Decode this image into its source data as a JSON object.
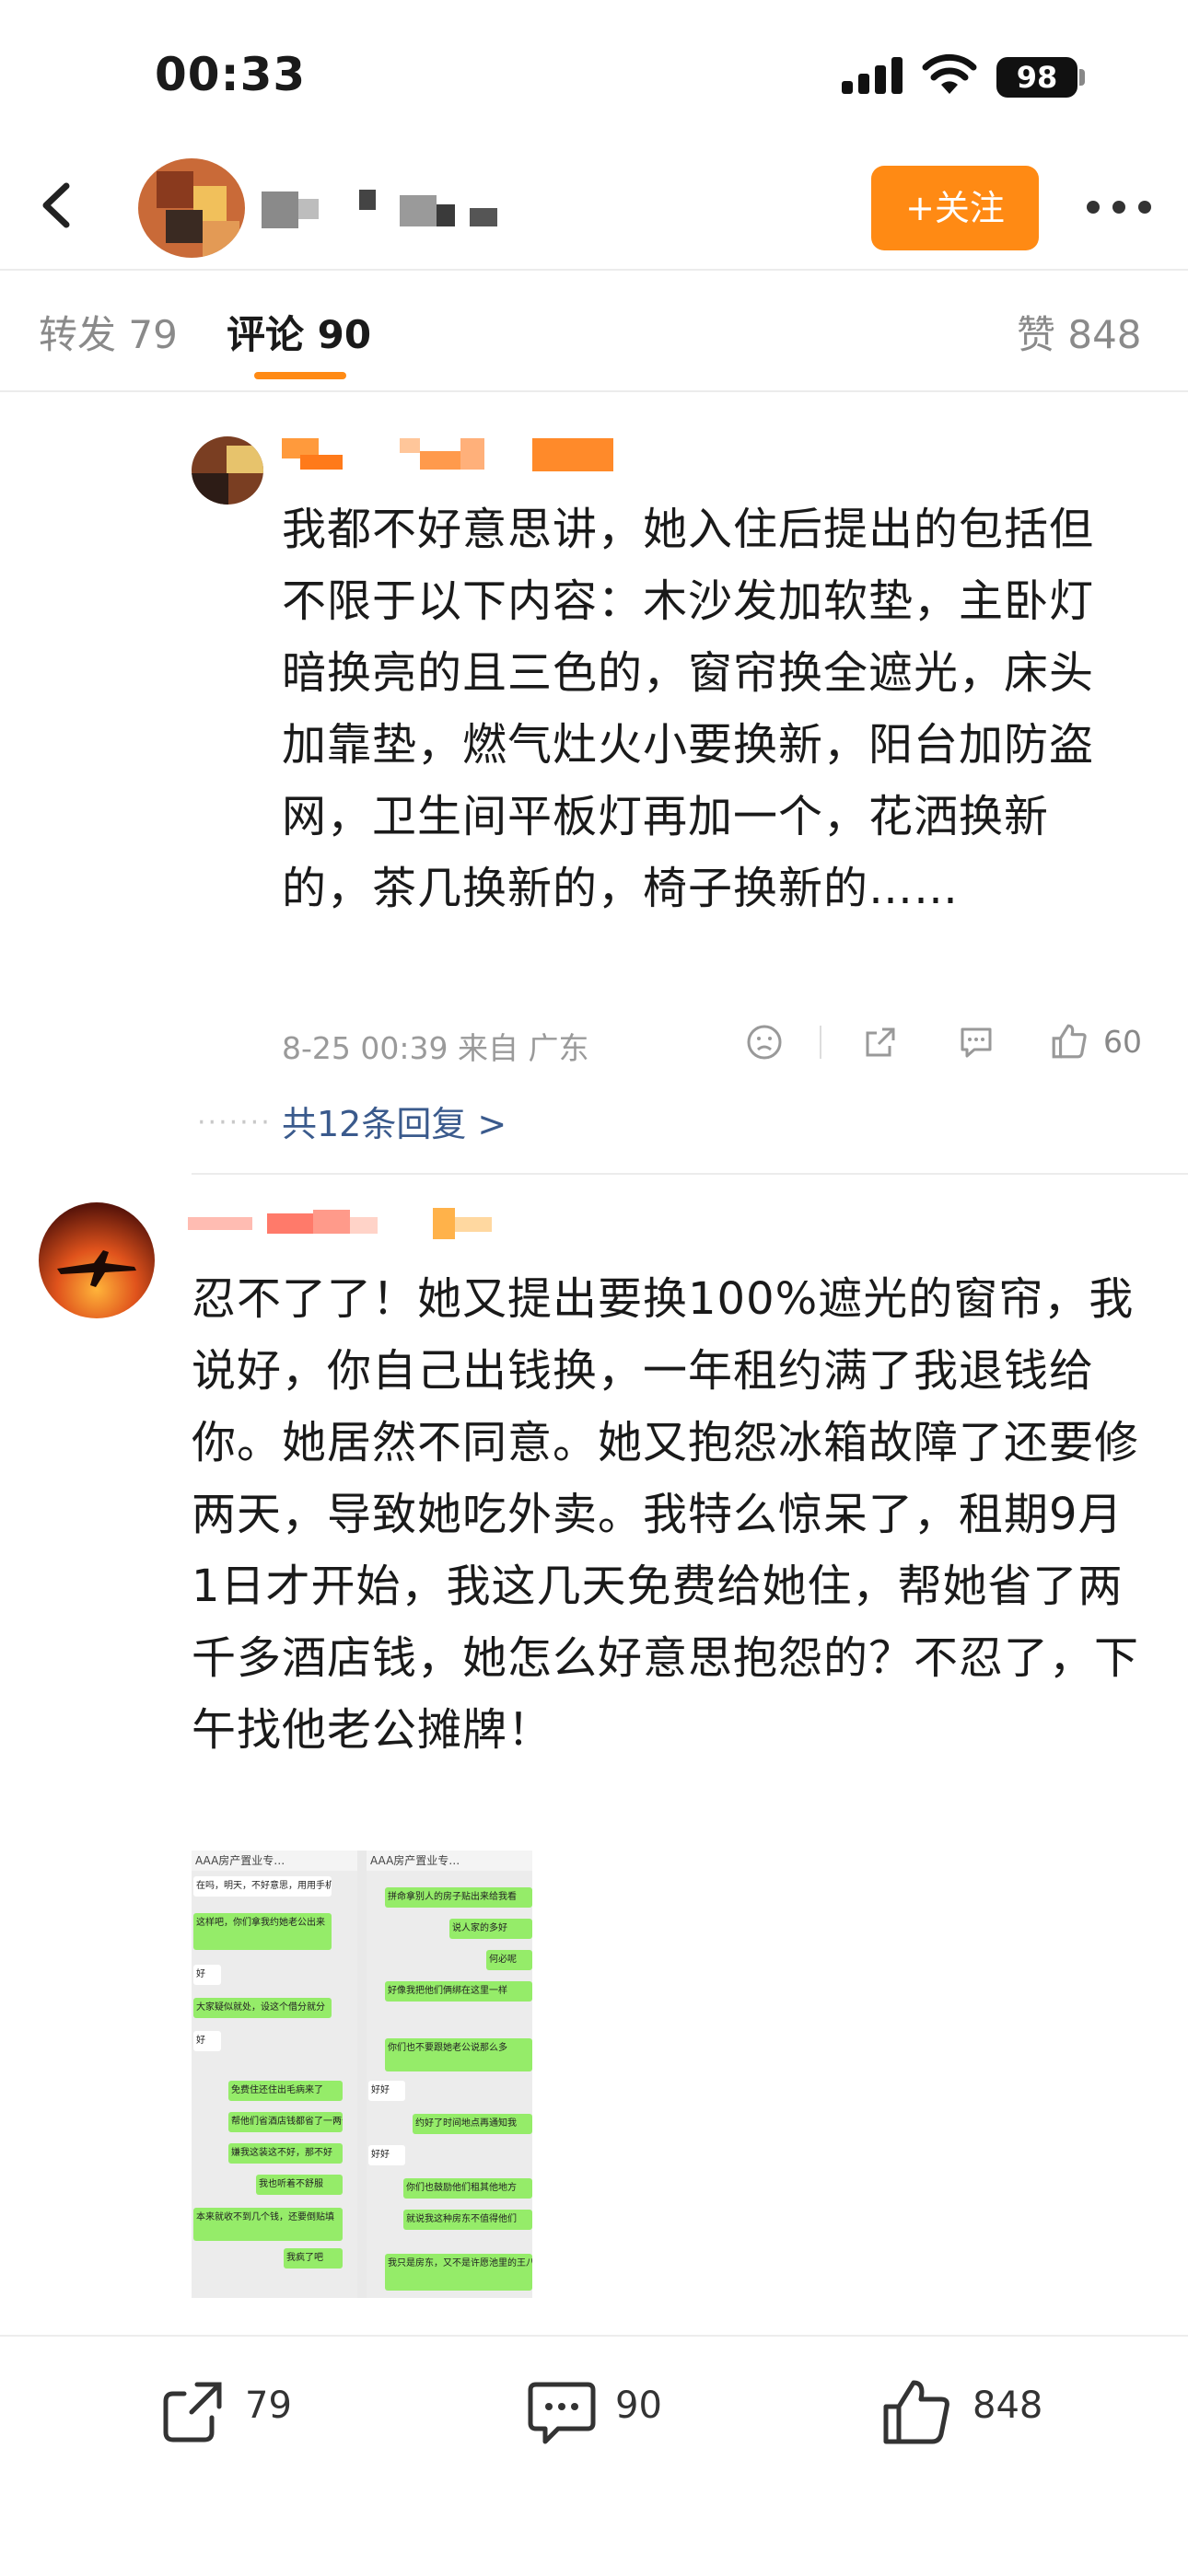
{
  "status_bar": {
    "time": "00:33",
    "battery": "98"
  },
  "header": {
    "follow_label": "+关注"
  },
  "tabs": [
    {
      "label": "转发 79"
    },
    {
      "label": "评论 90"
    },
    {
      "label": "赞 848"
    }
  ],
  "comments": [
    {
      "text": "我都不好意思讲，她入住后提出的包括但不限于以下内容：木沙发加软垫，主卧灯暗换亮的且三色的，窗帘换全遮光，床头加靠垫，燃气灶火小要换新，阳台加防盗网，卫生间平板灯再加一个，花洒换新的，茶几换新的，椅子换新的……",
      "meta": "8-25 00:39  来自 广东",
      "likes": "60",
      "replies_label": "共12条回复 >",
      "dots": "·······"
    },
    {
      "text": "忍不了了！她又提出要换100%遮光的窗帘，我说好，你自己出钱换，一年租约满了我退钱给你。她居然不同意。她又抱怨冰箱故障了还要修两天，导致她吃外卖。我特么惊呆了，租期9月1日才开始，我这几天免费给她住，帮她省了两千多酒店钱，她怎么好意思抱怨的？不忍了，下午找他老公摊牌！",
      "image": {
        "left_header": "AAA房产置业专…",
        "right_header": "AAA房产置业专…",
        "left_messages": [
          "在吗，明天，不好意思，用用手机",
          "这样吧，你们拿我约她老公出来",
          "好",
          "大家疑似就处，设这个借分就分",
          "好",
          "免费住还住出毛病来了",
          "帮他们省酒店钱都省了一两千",
          "嫌我这装这不好，那不好",
          "我也听着不舒服",
          "本来就收不到几个钱，还要倒贴填",
          "我疯了吧"
        ],
        "right_messages": [
          "拼命拿别人的房子贴出来给我看",
          "说人家的多好",
          "何必呢",
          "好像我把他们俩绑在这里一样",
          "你们也不要跟她老公说那么多",
          "好好",
          "约好了时间地点再通知我",
          "好好",
          "你们也鼓励他们租其他地方",
          "就说我这种房东不值得他们",
          "我只是房东，又不是许愿池里的王八，想住宫殿找别家"
        ]
      }
    }
  ],
  "bottom_bar": {
    "repost_count": "79",
    "comment_count": "90",
    "like_count": "848"
  }
}
